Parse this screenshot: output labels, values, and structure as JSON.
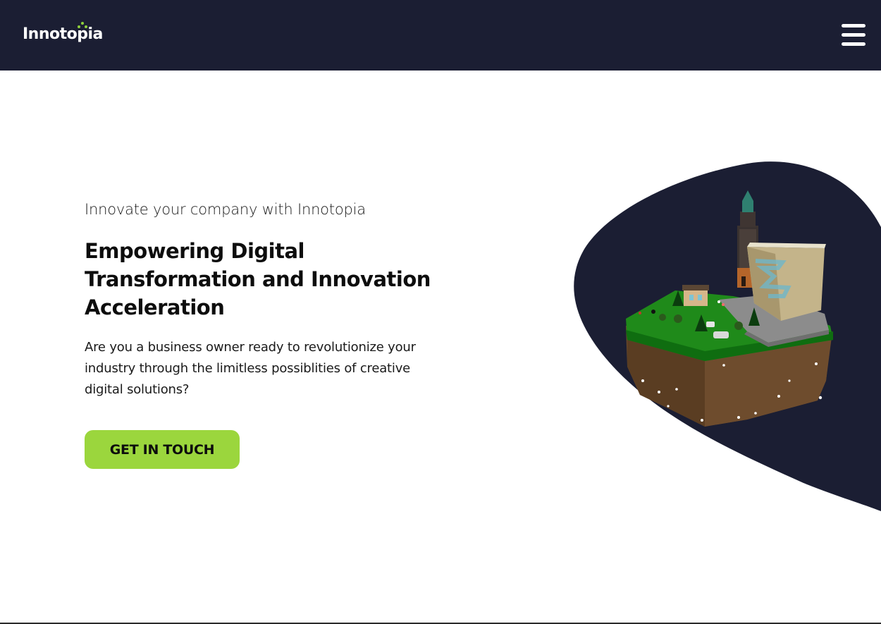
{
  "header": {
    "logo_text": "Innotopia",
    "menu_icon": "hamburger-menu-icon"
  },
  "hero": {
    "tagline": "Innovate your company with Innotopia",
    "headline": "Empowering Digital Transformation and Innovation Acceleration",
    "description": "Are you a business owner ready to revolutionize your industry through the limitless possiblities of creative digital solutions?",
    "cta_label": "GET IN TOUCH",
    "illustration": "3d-floating-island-city-illustration"
  },
  "colors": {
    "navy": "#1b1e33",
    "accent_green": "#9bd63d",
    "logo_dot_green": "#8ed13b"
  }
}
